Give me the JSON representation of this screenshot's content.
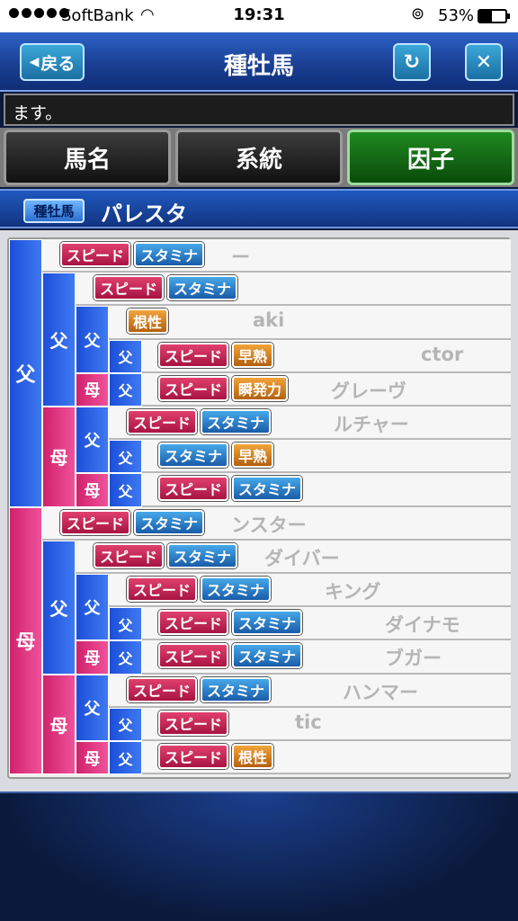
{
  "status": {
    "carrier": "SoftBank",
    "time": "19:31",
    "battery": "53%"
  },
  "header": {
    "back_label": "戻る",
    "title": "種牡馬",
    "refresh_icon": "refresh-icon",
    "close_icon": "close-icon"
  },
  "ticker": {
    "text": "ます。"
  },
  "tabs": [
    {
      "label": "馬名",
      "active": false
    },
    {
      "label": "系統",
      "active": false
    },
    {
      "label": "因子",
      "active": true
    }
  ],
  "horse": {
    "badge": "種牡馬",
    "name": "パレスタ"
  },
  "gen_labels": {
    "sire": "父",
    "dam": "母"
  },
  "rows": [
    {
      "name": "ー",
      "factors": [
        {
          "label": "スピード",
          "kind": "speed"
        },
        {
          "label": "スタミナ",
          "kind": "stamina"
        }
      ]
    },
    {
      "name": "",
      "factors": [
        {
          "label": "スピード",
          "kind": "speed"
        },
        {
          "label": "スタミナ",
          "kind": "stamina"
        }
      ]
    },
    {
      "name": "aki",
      "factors": [
        {
          "label": "根性",
          "kind": "gold"
        }
      ]
    },
    {
      "name": "ctor",
      "factors": [
        {
          "label": "スピード",
          "kind": "speed"
        },
        {
          "label": "早熟",
          "kind": "gold"
        }
      ]
    },
    {
      "name": "グレーヴ",
      "factors": [
        {
          "label": "スピード",
          "kind": "speed"
        },
        {
          "label": "瞬発力",
          "kind": "gold"
        }
      ]
    },
    {
      "name": "ルチャー",
      "factors": [
        {
          "label": "スピード",
          "kind": "speed"
        },
        {
          "label": "スタミナ",
          "kind": "stamina"
        }
      ]
    },
    {
      "name": "",
      "factors": [
        {
          "label": "スタミナ",
          "kind": "stamina"
        },
        {
          "label": "早熟",
          "kind": "gold"
        }
      ]
    },
    {
      "name": "",
      "factors": [
        {
          "label": "スピード",
          "kind": "speed"
        },
        {
          "label": "スタミナ",
          "kind": "stamina"
        }
      ]
    },
    {
      "name": "ンスター",
      "factors": [
        {
          "label": "スピード",
          "kind": "speed"
        },
        {
          "label": "スタミナ",
          "kind": "stamina"
        }
      ]
    },
    {
      "name": "ダイバー",
      "factors": [
        {
          "label": "スピード",
          "kind": "speed"
        },
        {
          "label": "スタミナ",
          "kind": "stamina"
        }
      ]
    },
    {
      "name": "キング",
      "factors": [
        {
          "label": "スピード",
          "kind": "speed"
        },
        {
          "label": "スタミナ",
          "kind": "stamina"
        }
      ]
    },
    {
      "name": "ダイナモ",
      "factors": [
        {
          "label": "スピード",
          "kind": "speed"
        },
        {
          "label": "スタミナ",
          "kind": "stamina"
        }
      ]
    },
    {
      "name": "ブガー",
      "factors": [
        {
          "label": "スピード",
          "kind": "speed"
        },
        {
          "label": "スタミナ",
          "kind": "stamina"
        }
      ]
    },
    {
      "name": "ハンマー",
      "factors": [
        {
          "label": "スピード",
          "kind": "speed"
        },
        {
          "label": "スタミナ",
          "kind": "stamina"
        }
      ]
    },
    {
      "name": "tic",
      "factors": [
        {
          "label": "スピード",
          "kind": "speed"
        }
      ]
    },
    {
      "name": "",
      "factors": [
        {
          "label": "スピード",
          "kind": "speed"
        },
        {
          "label": "根性",
          "kind": "gold"
        }
      ]
    }
  ]
}
